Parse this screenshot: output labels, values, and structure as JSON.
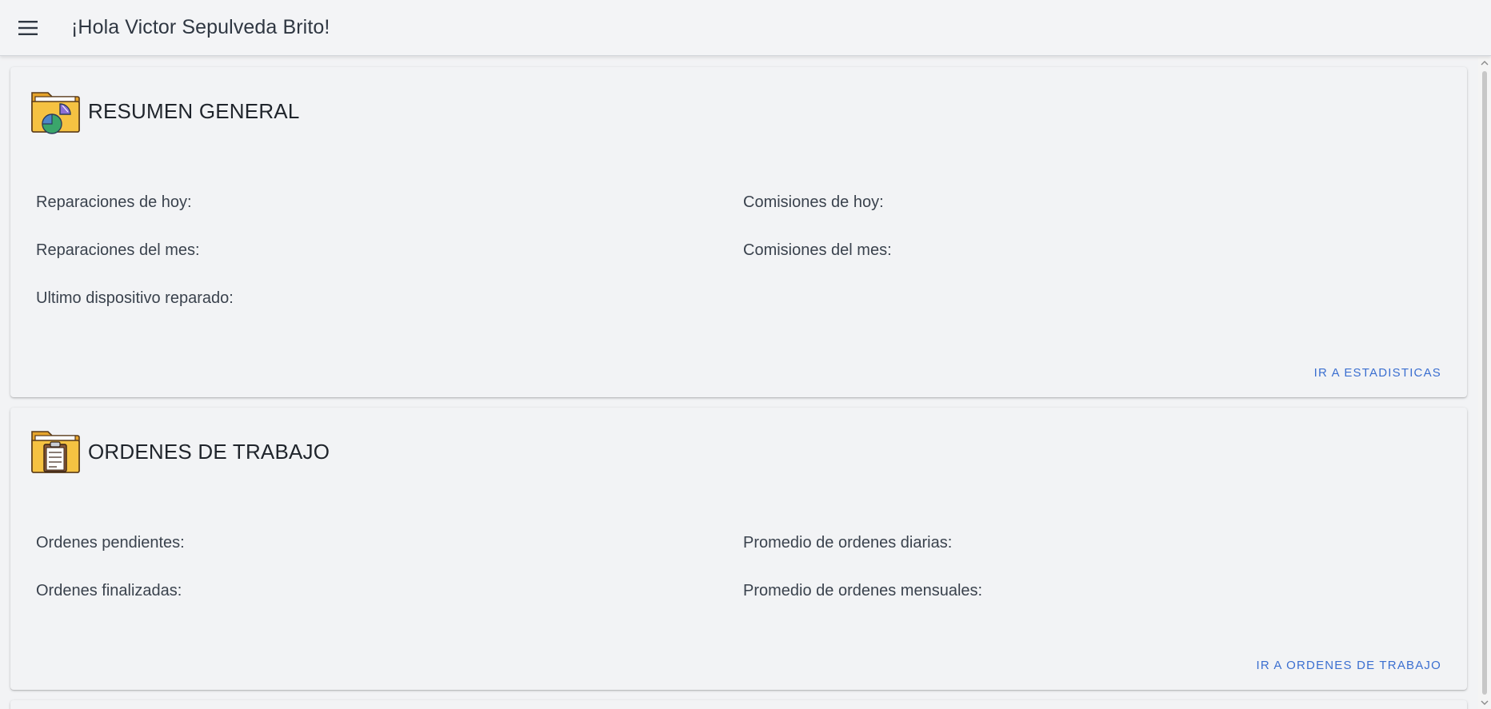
{
  "header": {
    "greeting": "¡Hola Victor Sepulveda Brito!",
    "menu_icon": "hamburger-menu-icon"
  },
  "summary_card": {
    "title": "RESUMEN GENERAL",
    "icon": "folder-pie-chart-icon",
    "repairs_today_label": "Reparaciones de hoy:",
    "repairs_month_label": "Reparaciones del mes:",
    "last_device_label": "Ultimo dispositivo reparado:",
    "commissions_today_label": "Comisiones de hoy:",
    "commissions_month_label": "Comisiones del mes:",
    "link_label": "IR A ESTADISTICAS"
  },
  "orders_card": {
    "title": "ORDENES DE TRABAJO",
    "icon": "folder-clipboard-icon",
    "pending_label": "Ordenes pendientes:",
    "finished_label": "Ordenes finalizadas:",
    "daily_avg_label": "Promedio de ordenes diarias:",
    "monthly_avg_label": "Promedio de ordenes mensuales:",
    "link_label": "IR A ORDENES DE TRABAJO"
  },
  "colors": {
    "accent_link": "#3b6fd0",
    "background": "#f2f3f5",
    "folder": "#f5c242"
  }
}
